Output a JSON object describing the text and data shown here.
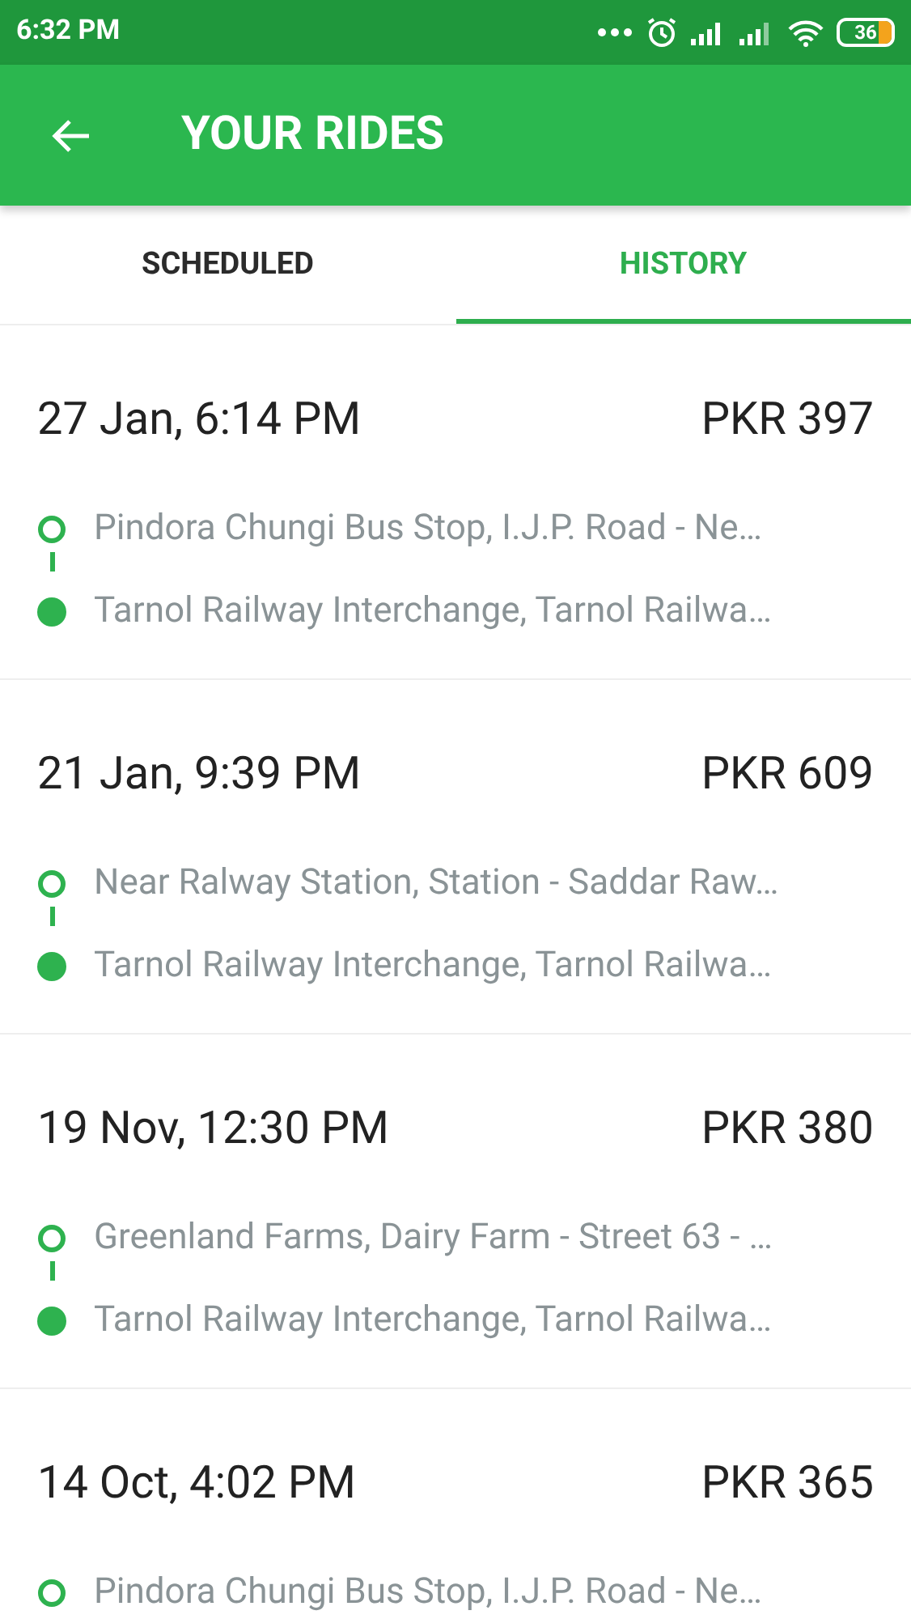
{
  "status_bar": {
    "time": "6:32 PM",
    "battery": "36"
  },
  "app_bar": {
    "title": "YOUR RIDES"
  },
  "tabs": [
    {
      "label": "SCHEDULED",
      "selected": false
    },
    {
      "label": "HISTORY",
      "selected": true
    }
  ],
  "rides": [
    {
      "date": "27 Jan, 6:14 PM",
      "fare": "PKR 397",
      "stops": [
        {
          "kind": "pickup",
          "address": "Pindora Chungi Bus Stop, I.J.P. Road - Ne…"
        },
        {
          "kind": "dropoff",
          "address": "Tarnol Railway Interchange, Tarnol Railwa…"
        }
      ]
    },
    {
      "date": "21 Jan, 9:39 PM",
      "fare": "PKR 609",
      "stops": [
        {
          "kind": "pickup",
          "address": "Near Ralway Station, Station - Saddar Raw…"
        },
        {
          "kind": "dropoff",
          "address": "Tarnol Railway Interchange, Tarnol Railwa…"
        }
      ]
    },
    {
      "date": "19 Nov, 12:30 PM",
      "fare": "PKR 380",
      "stops": [
        {
          "kind": "pickup",
          "address": "Greenland Farms, Dairy Farm - Street 63 - …"
        },
        {
          "kind": "dropoff",
          "address": "Tarnol Railway Interchange, Tarnol Railwa…"
        }
      ]
    },
    {
      "date": "14 Oct, 4:02 PM",
      "fare": "PKR 365",
      "stops": [
        {
          "kind": "pickup",
          "address": "Pindora Chungi Bus Stop, I.J.P. Road - Ne…"
        }
      ]
    }
  ]
}
